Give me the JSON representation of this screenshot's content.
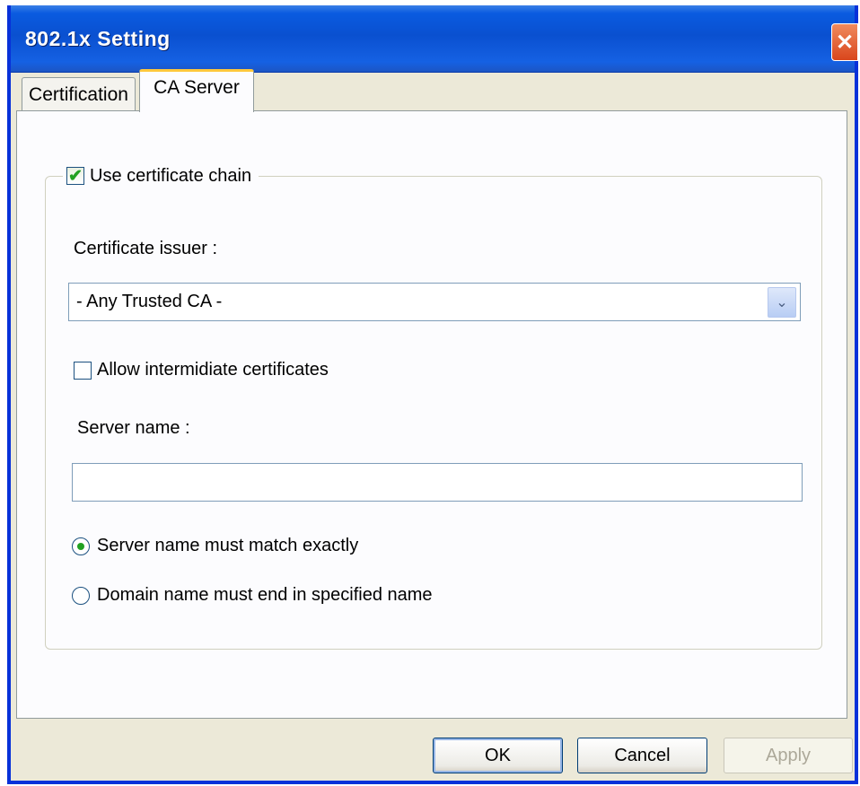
{
  "window": {
    "title": "802.1x Setting",
    "close_glyph": "✕"
  },
  "tabs": [
    {
      "label": "Certification",
      "active": false
    },
    {
      "label": "CA Server",
      "active": true
    }
  ],
  "group": {
    "checkbox_label": "Use certificate chain",
    "checked": true
  },
  "issuer": {
    "label": "Certificate issuer :",
    "selected": "- Any Trusted CA -"
  },
  "allow_intermediate": {
    "label": "Allow intermidiate certificates",
    "checked": false
  },
  "server": {
    "label": "Server name :",
    "value": "",
    "placeholder": ""
  },
  "radios": [
    {
      "label": "Server name must match exactly",
      "selected": true
    },
    {
      "label": "Domain name must end in specified name",
      "selected": false
    }
  ],
  "buttons": {
    "ok": "OK",
    "cancel": "Cancel",
    "apply": "Apply"
  },
  "icons": {
    "check": "✔",
    "dropdown": "⌄"
  },
  "colors": {
    "titlebar": "#0a50d0",
    "accent_check": "#21a121",
    "tab_highlight": "#ffc83c"
  }
}
